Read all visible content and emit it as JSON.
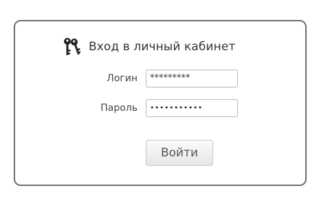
{
  "form": {
    "title": "Вход в личный кабинет",
    "icon": "keys-icon",
    "login": {
      "label": "Логин",
      "value": "*********"
    },
    "password": {
      "label": "Пароль",
      "value": "•••••••••••"
    },
    "submit_label": "Войти"
  },
  "colors": {
    "border": "#6d6d6d",
    "text": "#333333"
  }
}
